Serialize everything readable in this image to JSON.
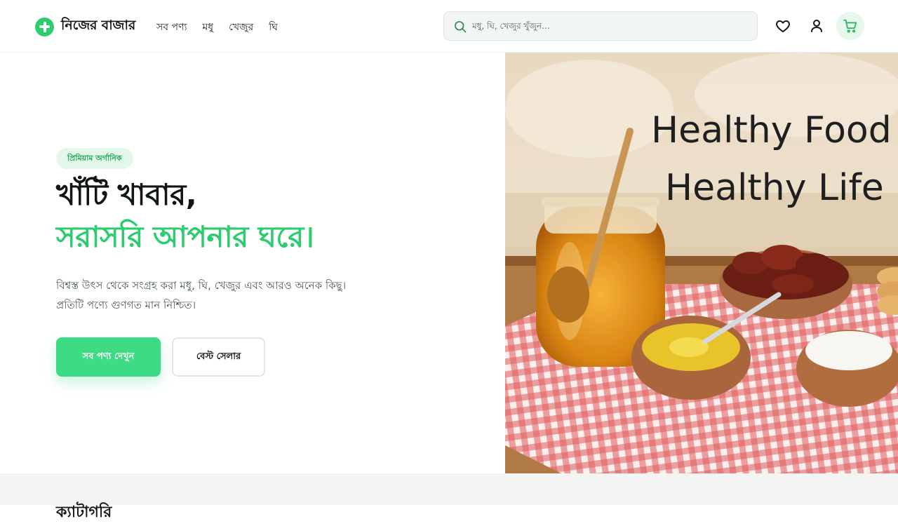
{
  "brand": {
    "name": "নিজের বাজার"
  },
  "nav": [
    {
      "label": "সব পণ্য"
    },
    {
      "label": "মধু"
    },
    {
      "label": "খেজুর"
    },
    {
      "label": "ঘি"
    }
  ],
  "search": {
    "placeholder": "মধু, ঘি, খেজুর খুঁজুন..."
  },
  "header_icons": [
    "heart-icon",
    "user-icon",
    "cart-icon"
  ],
  "hero": {
    "badge": "প্রিমিয়াম অর্গানিক",
    "title_line1": "খাঁটি খাবার,",
    "title_line2": "সরাসরি আপনার ঘরে।",
    "description_line1": "বিশ্বস্ত উৎস থেকে সংগ্রহ করা মধু, ঘি, খেজুর এবং আরও অনেক কিছু।",
    "description_line2": "প্রতিটি পণ্যে গুণগত মান নিশ্চিত।",
    "primary_button": "সব পণ্য দেখুন",
    "secondary_button": "বেস্ট সেলার",
    "image_text_line1": "Healthy Food",
    "image_text_line2": "Healthy Life"
  },
  "next_section": {
    "title": "ক্যাটাগরি"
  },
  "colors": {
    "accent": "#2ecc71",
    "button": "#3ddc84",
    "badge_bg": "#e4f7eb"
  }
}
